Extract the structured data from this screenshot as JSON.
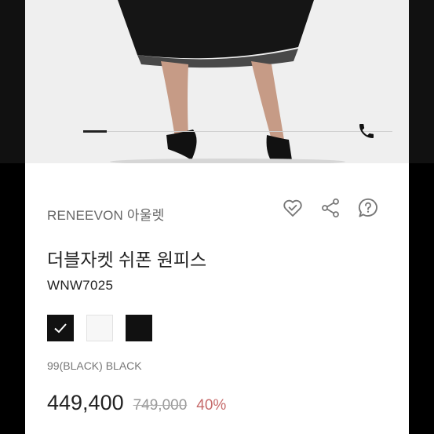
{
  "product": {
    "brand": "RENEEVON 아울렛",
    "name": "더블자켓 쉬폰 원피스",
    "code": "WNW7025",
    "selected_color": "99(BLACK) BLACK",
    "price_current": "449,400",
    "price_original": "749,000",
    "discount": "40%"
  },
  "swatches": [
    {
      "name": "black-selected",
      "color": "#111111"
    },
    {
      "name": "white",
      "color": "#f7f7f7"
    },
    {
      "name": "black",
      "color": "#111111"
    }
  ],
  "icons": {
    "wishlist": "heart-icon",
    "share": "share-icon",
    "inquiry": "question-chat-icon",
    "phone": "phone-icon"
  },
  "colors": {
    "discount": "#c66a6a",
    "brand_text": "#666666"
  }
}
